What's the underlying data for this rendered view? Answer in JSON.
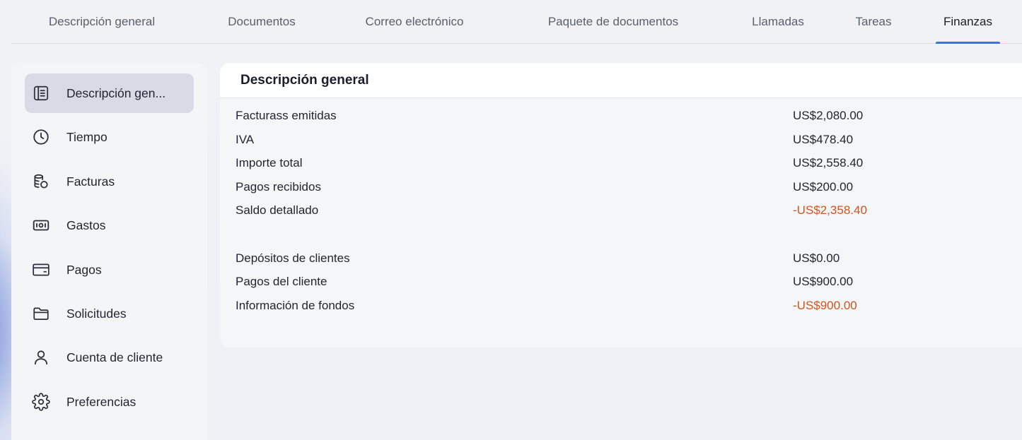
{
  "tabs": [
    {
      "label": "Descripción general",
      "active": false
    },
    {
      "label": "Documentos",
      "active": false
    },
    {
      "label": "Correo electrónico",
      "active": false
    },
    {
      "label": "Paquete de documentos",
      "active": false
    },
    {
      "label": "Llamadas",
      "active": false
    },
    {
      "label": "Tareas",
      "active": false
    },
    {
      "label": "Finanzas",
      "active": true
    }
  ],
  "sidebar": {
    "items": [
      {
        "label": "Descripción gen...",
        "icon": "overview-icon",
        "active": true
      },
      {
        "label": "Tiempo",
        "icon": "clock-icon",
        "active": false
      },
      {
        "label": "Facturas",
        "icon": "invoice-coins-icon",
        "active": false
      },
      {
        "label": "Gastos",
        "icon": "expenses-cash-icon",
        "active": false
      },
      {
        "label": "Pagos",
        "icon": "wallet-icon",
        "active": false
      },
      {
        "label": "Solicitudes",
        "icon": "folder-icon",
        "active": false
      },
      {
        "label": "Cuenta de cliente",
        "icon": "user-icon",
        "active": false
      },
      {
        "label": "Preferencias",
        "icon": "gear-icon",
        "active": false
      }
    ]
  },
  "panel": {
    "title": "Descripción general",
    "summary": [
      {
        "label": "Facturass emitidas",
        "value": "US$2,080.00",
        "negative": false
      },
      {
        "label": "IVA",
        "value": "US$478.40",
        "negative": false
      },
      {
        "label": "Importe total",
        "value": "US$2,558.40",
        "negative": false
      },
      {
        "label": "Pagos recibidos",
        "value": "US$200.00",
        "negative": false
      },
      {
        "label": "Saldo detallado",
        "value": "-US$2,358.40",
        "negative": true
      }
    ],
    "funds": [
      {
        "label": "Depósitos de clientes",
        "value": "US$0.00",
        "negative": false
      },
      {
        "label": "Pagos del cliente",
        "value": "US$900.00",
        "negative": false
      },
      {
        "label": "Información de fondos",
        "value": "-US$900.00",
        "negative": true
      }
    ]
  },
  "colors": {
    "accent": "#2a7be4",
    "negative": "#d35220",
    "active_nav_bg": "#d8dae5"
  }
}
